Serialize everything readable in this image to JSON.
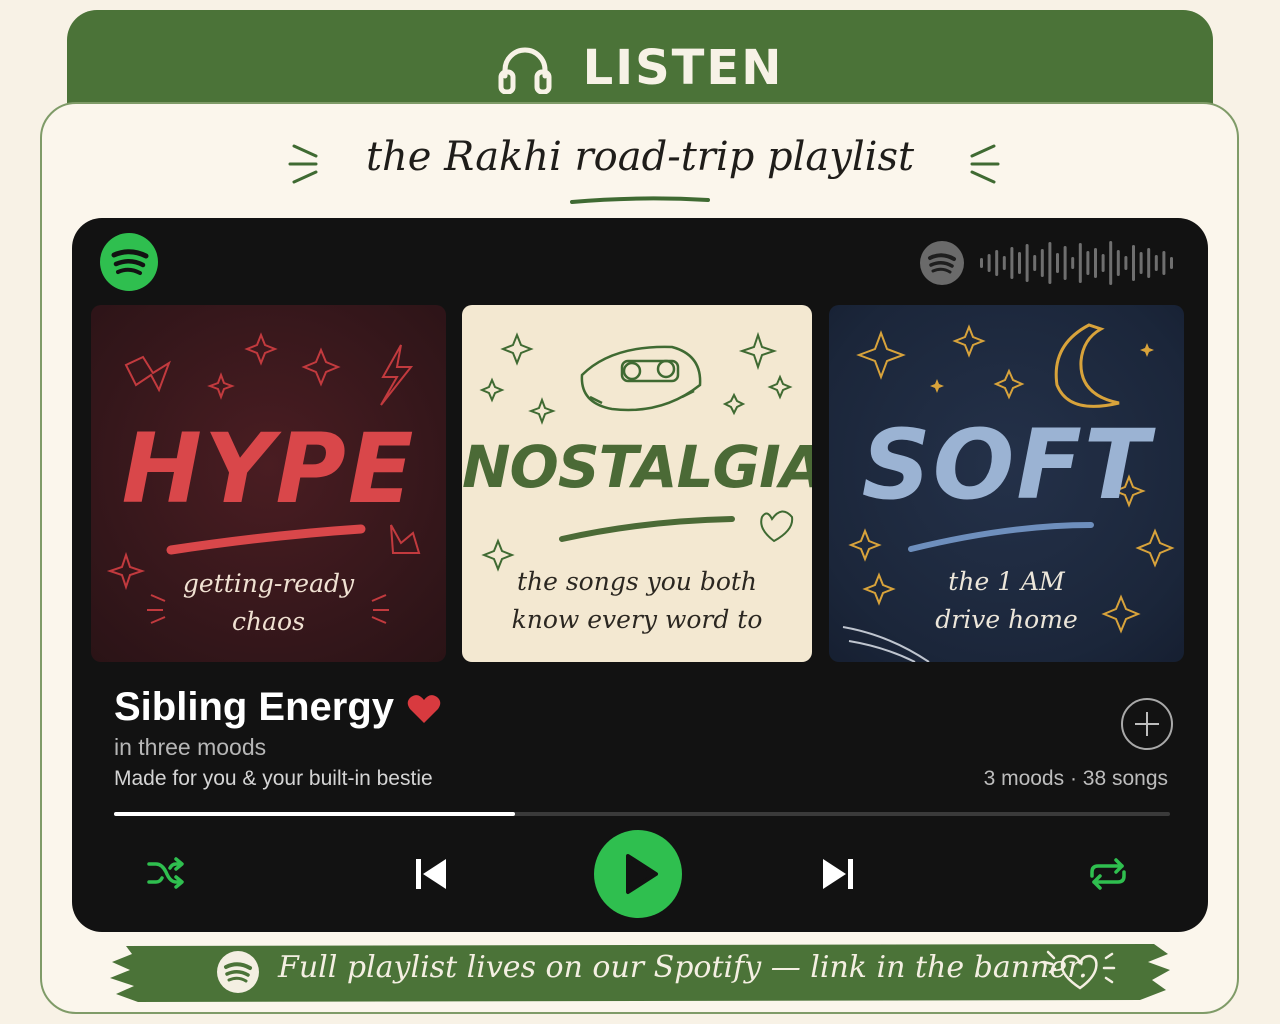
{
  "header": {
    "title": "LISTEN",
    "icon": "headphones-icon"
  },
  "subtitle": "the Rakhi road-trip playlist",
  "covers": [
    {
      "title": "HYPE",
      "caption_line1": "getting-ready",
      "caption_line2": "chaos",
      "color": "#d9474a"
    },
    {
      "title": "NOSTALGIA",
      "caption_line1": "the songs you both",
      "caption_line2": "know every word to",
      "color": "#4b6a36"
    },
    {
      "title": "SOFT",
      "caption_line1": "the 1 AM",
      "caption_line2": "drive home",
      "color": "#9bb3d3"
    }
  ],
  "playlist": {
    "title": "Sibling Energy",
    "subtitle": "in three moods",
    "description": "Made for you & your built-in bestie",
    "meta": "3 moods · 38 songs",
    "progress": 0.38
  },
  "controls": [
    "shuffle",
    "previous",
    "play",
    "next",
    "repeat"
  ],
  "footer": {
    "text": "Full playlist lives on our Spotify — link in the banner."
  },
  "colors": {
    "accent": "#2fbf4f",
    "brand_green": "#4b7338",
    "heart": "#d83a3f",
    "player_bg": "#121212"
  }
}
